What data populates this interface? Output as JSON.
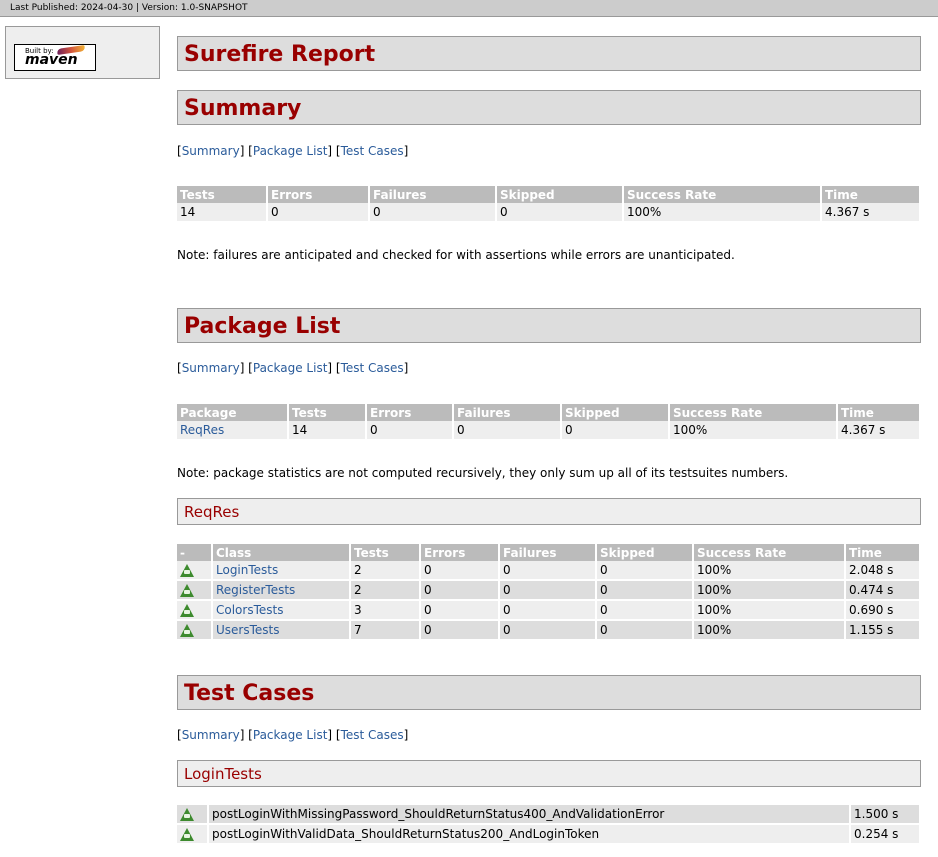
{
  "banner": {
    "text": "Last Published: 2024-04-30 | Version: 1.0-SNAPSHOT"
  },
  "logo": {
    "built_by": "Built by:",
    "name": "maven"
  },
  "title": "Surefire Report",
  "nav": {
    "summary": "Summary",
    "package_list": "Package List",
    "test_cases": "Test Cases"
  },
  "summary": {
    "heading": "Summary",
    "headers": [
      "Tests",
      "Errors",
      "Failures",
      "Skipped",
      "Success Rate",
      "Time"
    ],
    "row": [
      "14",
      "0",
      "0",
      "0",
      "100%",
      "4.367 s"
    ],
    "note": "Note: failures are anticipated and checked for with assertions while errors are unanticipated."
  },
  "package_list": {
    "heading": "Package List",
    "headers": [
      "Package",
      "Tests",
      "Errors",
      "Failures",
      "Skipped",
      "Success Rate",
      "Time"
    ],
    "row": [
      "ReqRes",
      "14",
      "0",
      "0",
      "0",
      "100%",
      "4.367 s"
    ],
    "note": "Note: package statistics are not computed recursively, they only sum up all of its testsuites numbers."
  },
  "reqres": {
    "heading": "ReqRes",
    "headers": [
      "-",
      "Class",
      "Tests",
      "Errors",
      "Failures",
      "Skipped",
      "Success Rate",
      "Time"
    ],
    "rows": [
      [
        "LoginTests",
        "2",
        "0",
        "0",
        "0",
        "100%",
        "2.048 s"
      ],
      [
        "RegisterTests",
        "2",
        "0",
        "0",
        "0",
        "100%",
        "0.474 s"
      ],
      [
        "ColorsTests",
        "3",
        "0",
        "0",
        "0",
        "100%",
        "0.690 s"
      ],
      [
        "UsersTests",
        "7",
        "0",
        "0",
        "0",
        "100%",
        "1.155 s"
      ]
    ]
  },
  "test_cases": {
    "heading": "Test Cases",
    "login_heading": "LoginTests",
    "rows": [
      [
        "postLoginWithMissingPassword_ShouldReturnStatus400_AndValidationError",
        "1.500 s"
      ],
      [
        "postLoginWithValidData_ShouldReturnStatus200_AndLoginToken",
        "0.254 s"
      ]
    ]
  },
  "icons": {
    "success": "success-icon"
  }
}
